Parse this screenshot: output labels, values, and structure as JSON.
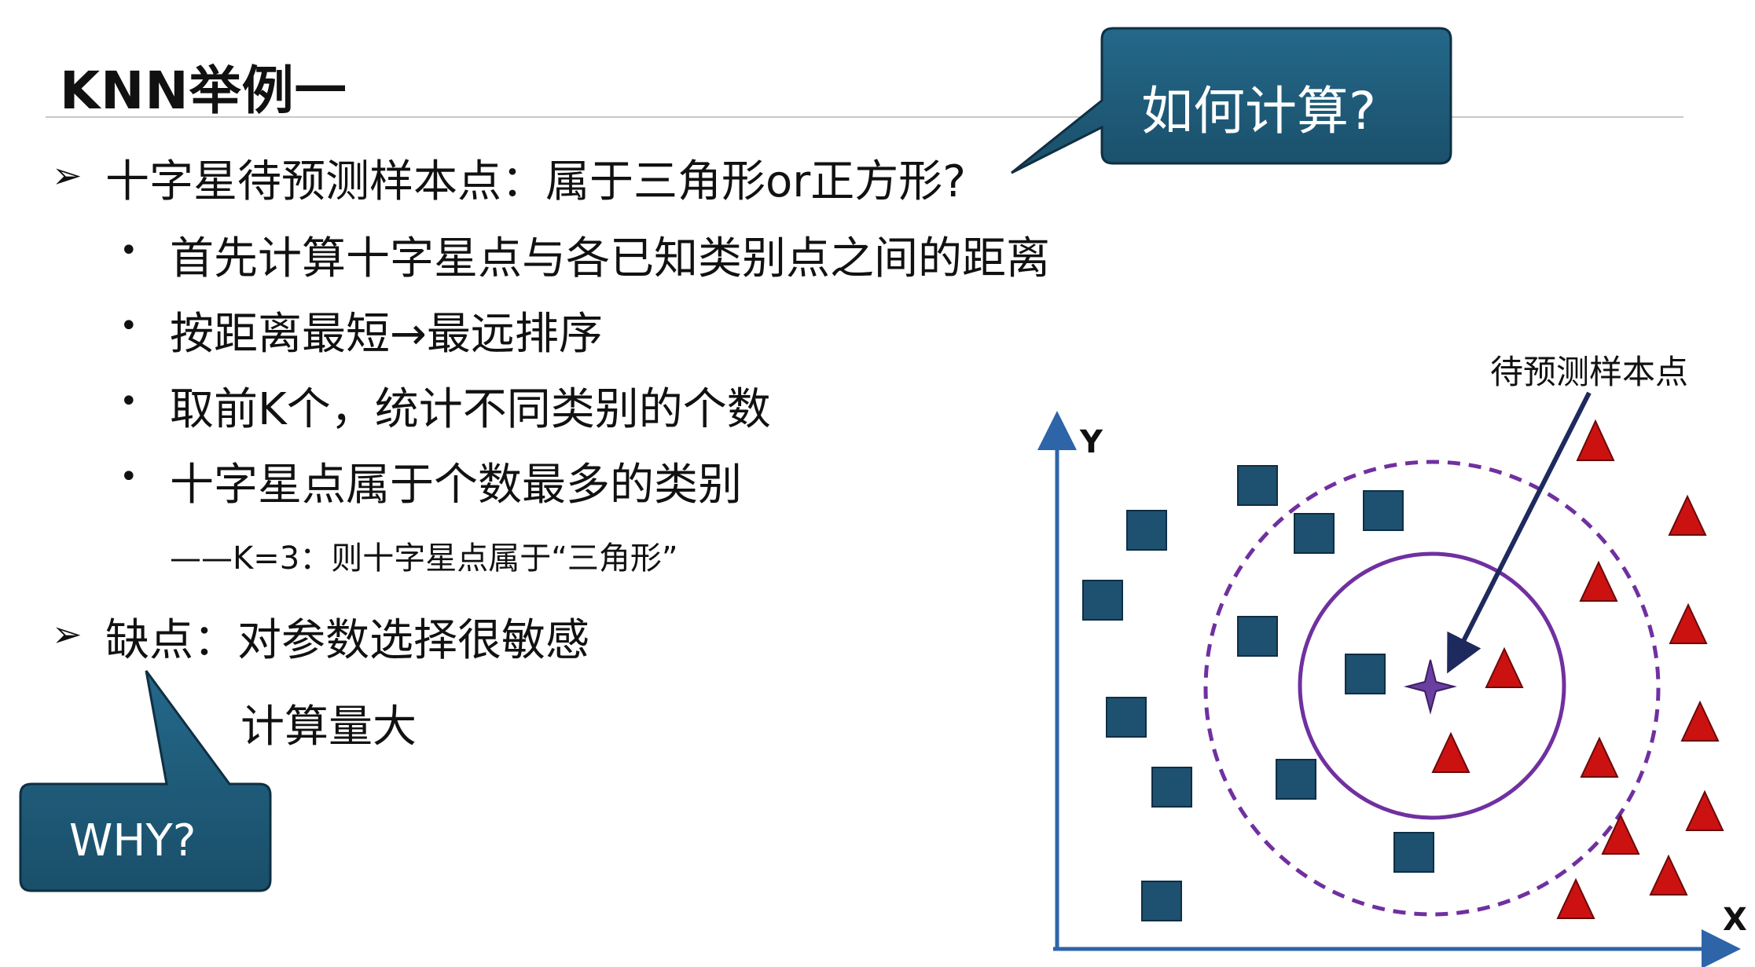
{
  "slide": {
    "title": "KNN举例一",
    "points": [
      {
        "bullet": "➢",
        "text": "十字星待预测样本点：属于三角形or正方形?"
      },
      {
        "bullet": "•",
        "text": "首先计算十字星点与各已知类别点之间的距离"
      },
      {
        "bullet": "•",
        "text": "按距离最短→最远排序"
      },
      {
        "bullet": "•",
        "text": "取前K个，统计不同类别的个数"
      },
      {
        "bullet": "•",
        "text": "十字星点属于个数最多的类别"
      },
      {
        "text": "——K=3：则十字星点属于“三角形”"
      },
      {
        "bullet": "➢",
        "text": "缺点：对参数选择很敏感"
      },
      {
        "text": "计算量大"
      }
    ],
    "callout_top": "如何计算?",
    "callout_bottom": "WHY?"
  },
  "diagram": {
    "x_axis_label": "X",
    "y_axis_label": "Y",
    "query_label": "待预测样本点"
  },
  "colors": {
    "callout_fill": "#1e5b78",
    "square": "#1e5070",
    "triangle": "#cc1111",
    "circle": "#7030a0",
    "axis": "#2e64a8",
    "arrow": "#1e2a5e"
  }
}
